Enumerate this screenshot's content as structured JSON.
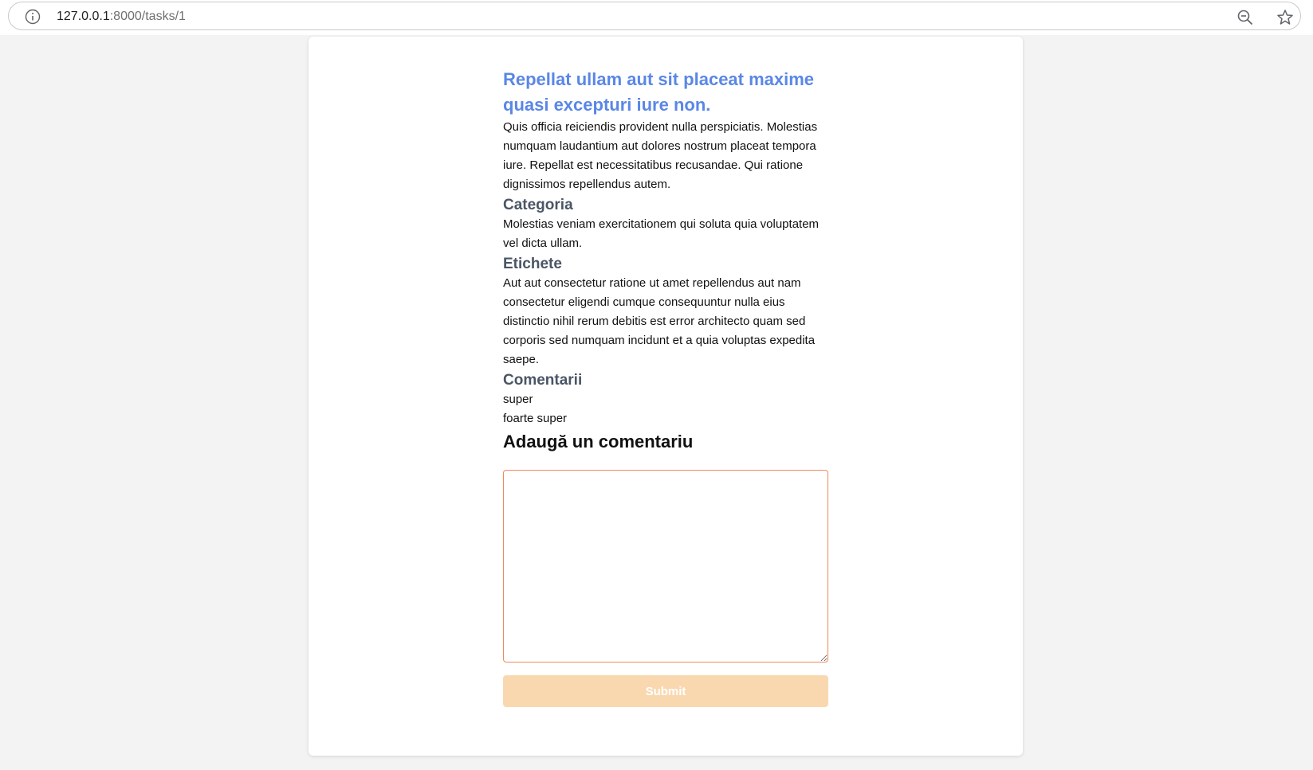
{
  "browser": {
    "url_host": "127.0.0.1",
    "url_path": ":8000/tasks/1"
  },
  "task": {
    "title": "Repellat ullam aut sit placeat maxime quasi excepturi iure non.",
    "description": "Quis officia reiciendis provident nulla perspiciatis. Molestias numquam laudantium aut dolores nostrum placeat tempora iure. Repellat est necessitatibus recusandae. Qui ratione dignissimos repellendus autem.",
    "category_heading": "Categoria",
    "category_text": "Molestias veniam exercitationem qui soluta quia voluptatem vel dicta ullam.",
    "tags_heading": "Etichete",
    "tags_text": "Aut aut consectetur ratione ut amet repellendus aut nam consectetur eligendi cumque consequuntur nulla eius distinctio nihil rerum debitis est error architecto quam sed corporis sed numquam incidunt et a quia voluptas expedita saepe.",
    "comments_heading": "Comentarii",
    "comments": [
      "super",
      "foarte super"
    ]
  },
  "comment_form": {
    "heading": "Adaugă un comentariu",
    "textarea_value": "",
    "submit_label": "Submit"
  },
  "colors": {
    "title": "#5a87e6",
    "section_heading": "#4a5565",
    "textarea_border": "#ef8a5c",
    "submit_bg": "#f9d8b0"
  },
  "icons": {
    "info": "info-icon",
    "zoom": "zoom-out-icon",
    "bookmark": "star-icon"
  }
}
